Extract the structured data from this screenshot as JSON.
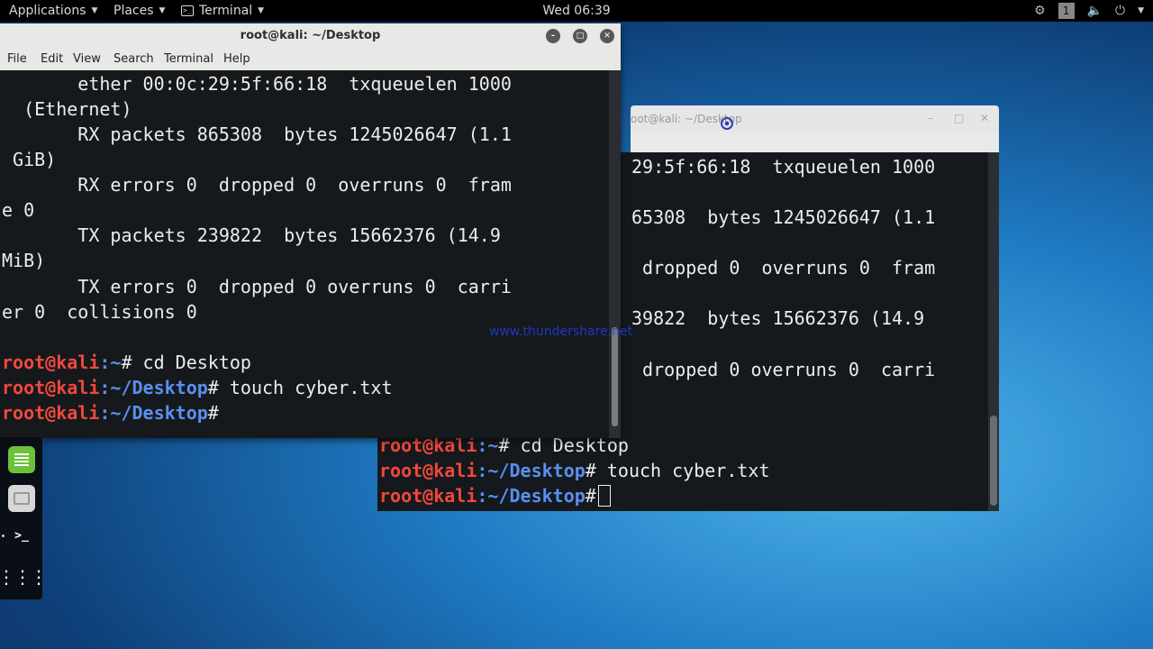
{
  "top_panel": {
    "applications": "Applications",
    "places": "Places",
    "terminal": "Terminal",
    "clock": "Wed 06:39",
    "workspace": "1"
  },
  "window_front": {
    "title": "root@kali: ~/Desktop",
    "menu": [
      "File",
      "Edit",
      "View",
      "Search",
      "Terminal",
      "Help"
    ],
    "lines": [
      "       ether 00:0c:29:5f:66:18  txqueuelen 1000",
      "  (Ethernet)",
      "       RX packets 865308  bytes 1245026647 (1.1",
      " GiB)",
      "       RX errors 0  dropped 0  overruns 0  fram",
      "e 0",
      "       TX packets 239822  bytes 15662376 (14.9",
      "MiB)",
      "       TX errors 0  dropped 0 overruns 0  carri",
      "er 0  collisions 0",
      ""
    ],
    "prompts": [
      {
        "user": "root@kali",
        "path": ":~",
        "cmd": "# cd Desktop"
      },
      {
        "user": "root@kali",
        "path": ":~/Desktop",
        "cmd": "# touch cyber.txt"
      },
      {
        "user": "root@kali",
        "path": ":~/Desktop",
        "cmd": "#"
      }
    ]
  },
  "window_back": {
    "title": "oot@kali: ~/Desktop",
    "lines": [
      "29:5f:66:18  txqueuelen 1000",
      "",
      "65308  bytes 1245026647 (1.1",
      "",
      " dropped 0  overruns 0  fram",
      "",
      "39822  bytes 15662376 (14.9",
      "",
      " dropped 0 overruns 0  carri"
    ],
    "prompts": [
      {
        "user": "root@kali",
        "path": ":~",
        "cmd": "# cd Desktop"
      },
      {
        "user": "root@kali",
        "path": ":~/Desktop",
        "cmd": "# touch cyber.txt"
      },
      {
        "user": "root@kali",
        "path": ":~/Desktop",
        "cmd": "#"
      }
    ]
  },
  "watermark": "www.thundershare.net",
  "dock": [
    "notes-app-icon",
    "files-app-icon",
    "terminal-app-icon",
    "show-apps-icon"
  ]
}
